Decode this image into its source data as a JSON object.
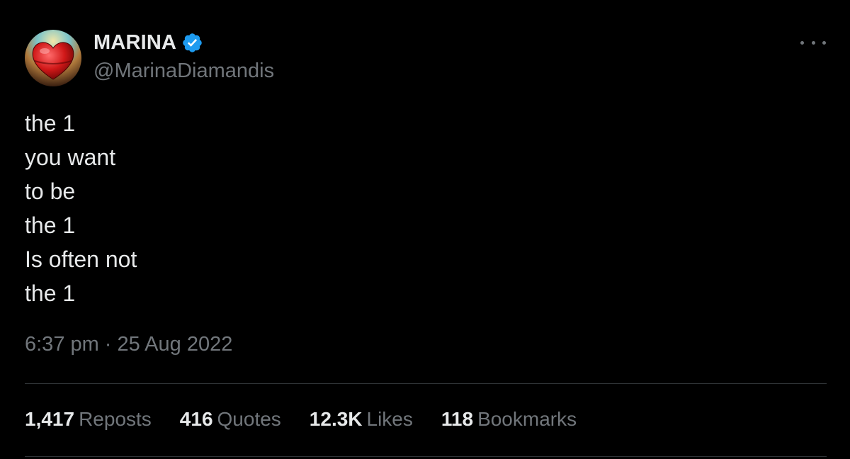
{
  "author": {
    "display_name": "MARINA",
    "handle": "@MarinaDiamandis",
    "verified": true,
    "avatar_icon": "heart-avatar-icon",
    "verified_color": "#1d9bf0"
  },
  "tweet": {
    "lines": [
      "the 1",
      "you want",
      "to be",
      "the 1",
      "Is often not",
      "the 1"
    ],
    "time": "6:37 pm",
    "separator": "·",
    "date": "25 Aug 2022"
  },
  "stats": [
    {
      "value": "1,417",
      "label": "Reposts"
    },
    {
      "value": "416",
      "label": "Quotes"
    },
    {
      "value": "12.3K",
      "label": "Likes"
    },
    {
      "value": "118",
      "label": "Bookmarks"
    }
  ],
  "colors": {
    "background": "#000000",
    "text": "#e7e9ea",
    "muted": "#71767b",
    "divider": "#2f3336"
  }
}
